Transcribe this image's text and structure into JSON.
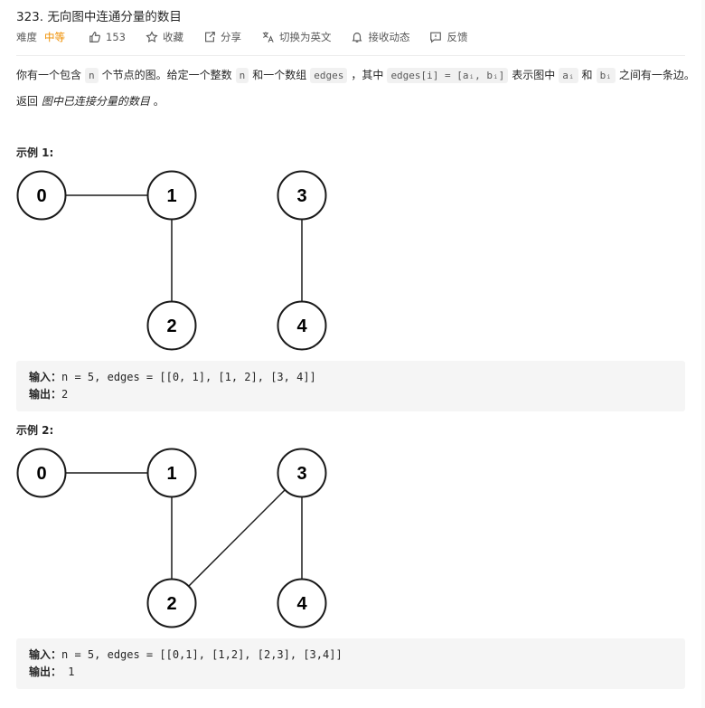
{
  "problem": {
    "title": "323. 无向图中连通分量的数目",
    "difficulty_label": "难度",
    "difficulty": "中等",
    "likes": "153",
    "favorite": "收藏",
    "share": "分享",
    "switch_lang": "切换为英文",
    "subscribe": "接收动态",
    "feedback": "反馈"
  },
  "description": {
    "p1_a": "你有一个包含",
    "p1_n": "n",
    "p1_b": "个节点的图。给定一个整数",
    "p1_n2": "n",
    "p1_c": "和一个数组",
    "p1_edges": "edges",
    "p1_d": "，其中",
    "p1_code": "edges[i] = [aᵢ, bᵢ]",
    "p1_e": "表示图中",
    "p1_ai": "aᵢ",
    "p1_f": "和",
    "p1_bi": "bᵢ",
    "p1_g": "之间有一条边。",
    "p2_a": "返回",
    "p2_em": "图中已连接分量的数目",
    "p2_b": "。"
  },
  "examples": [
    {
      "title": "示例 1:",
      "nodes": [
        "0",
        "1",
        "2",
        "3",
        "4"
      ],
      "edges": [
        [
          "0",
          "1"
        ],
        [
          "1",
          "2"
        ],
        [
          "3",
          "4"
        ]
      ],
      "input_label": "输入：",
      "input": "n = 5, edges = [[0, 1], [1, 2], [3, 4]]",
      "output_label": "输出：",
      "output": "2"
    },
    {
      "title": "示例 2:",
      "nodes": [
        "0",
        "1",
        "2",
        "3",
        "4"
      ],
      "edges": [
        [
          "0",
          "1"
        ],
        [
          "1",
          "2"
        ],
        [
          "2",
          "3"
        ],
        [
          "3",
          "4"
        ]
      ],
      "input_label": "输入：",
      "input": "n = 5, edges = [[0,1], [1,2], [2,3], [3,4]]",
      "output_label": "输出：",
      "output": " 1"
    }
  ]
}
